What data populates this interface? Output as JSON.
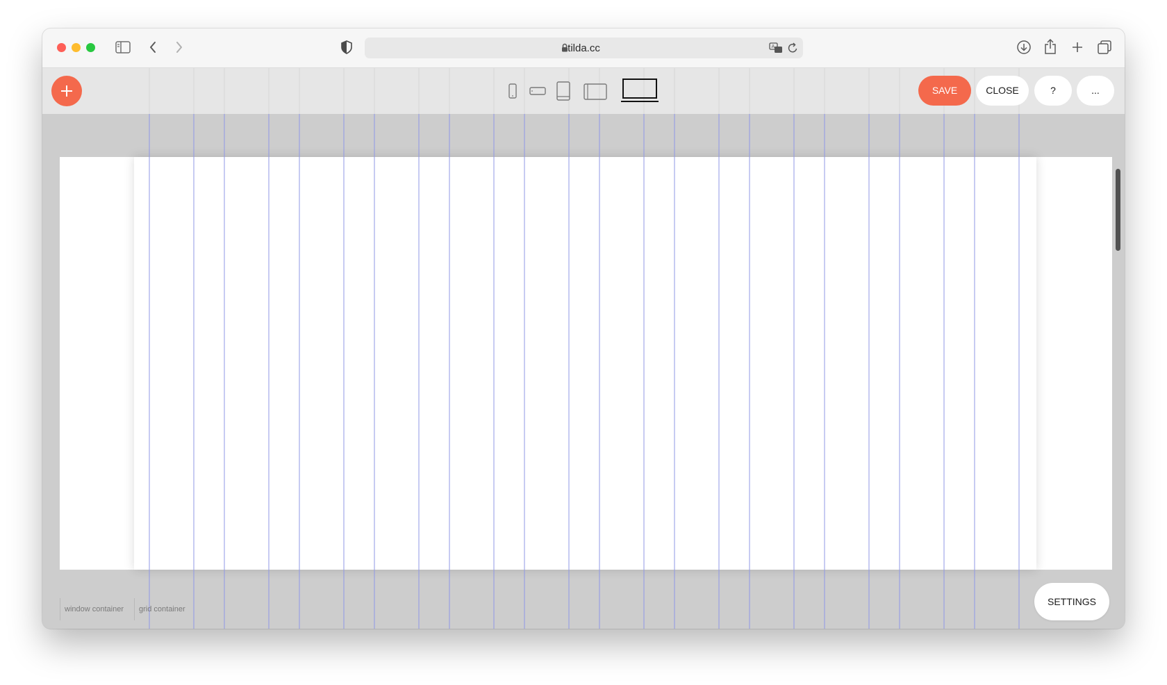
{
  "browser": {
    "url": "tilda.cc",
    "icons": [
      "sidebar-icon",
      "back-icon",
      "forward-icon",
      "shield-icon",
      "lock-icon",
      "translate-icon",
      "reload-icon",
      "download-icon",
      "share-icon",
      "new-tab-icon",
      "tab-overview-icon"
    ]
  },
  "editor": {
    "add_button_icon": "plus-icon",
    "devices": [
      "phone-portrait",
      "phone-landscape",
      "tablet-portrait",
      "tablet-landscape",
      "desktop"
    ],
    "active_device": "desktop",
    "save_label": "SAVE",
    "close_label": "CLOSE",
    "help_label": "?",
    "more_label": "...",
    "accent_color": "#f4694c"
  },
  "canvas": {
    "window_container_label": "window container",
    "grid_container_label": "grid container",
    "settings_label": "SETTINGS",
    "grid_line_color": "#8f97e6"
  }
}
